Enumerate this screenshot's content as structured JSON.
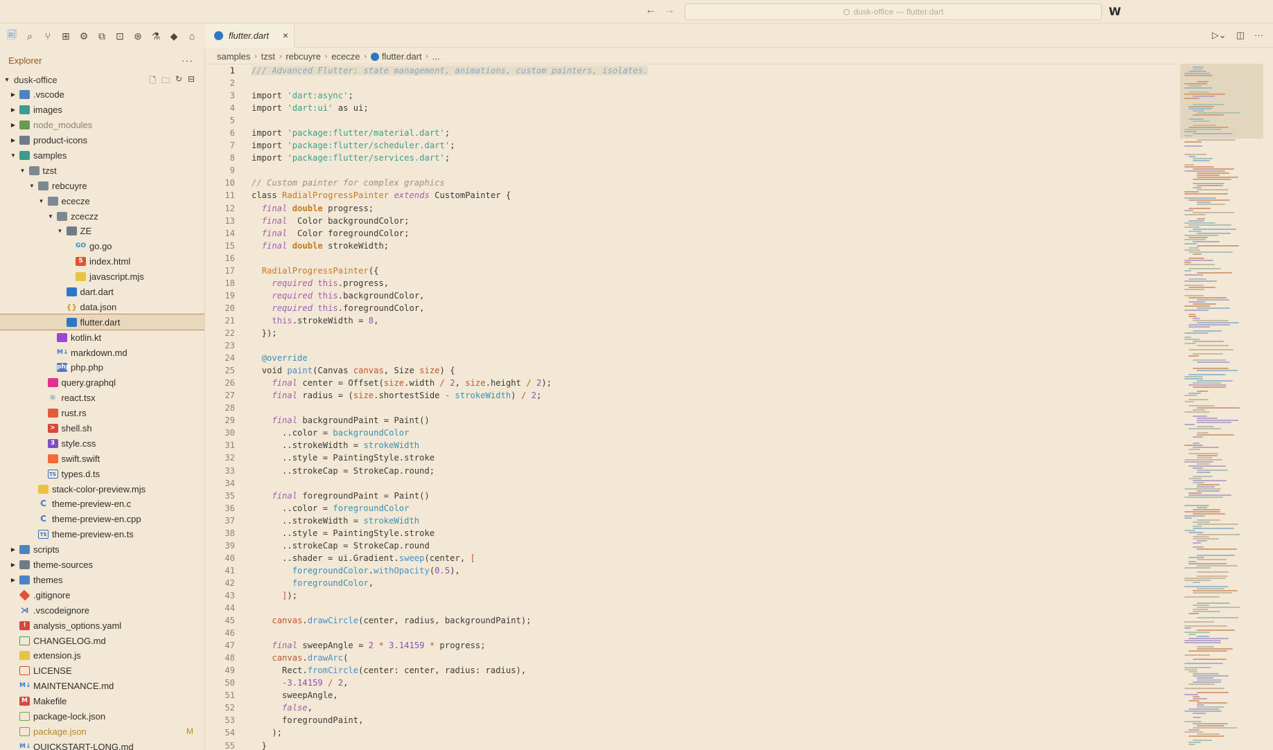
{
  "titlebar": {
    "search_text": "dusk-office — flutter.dart",
    "back_icon": "arrow-left-icon",
    "forward_icon": "arrow-right-icon",
    "logo_text": "W"
  },
  "activity": [
    "files-icon",
    "search-icon",
    "source-control-icon",
    "map-icon",
    "debug-icon",
    "remote-icon",
    "extensions-icon",
    "settings-sync-icon",
    "testing-icon",
    "dart-icon",
    "docker-icon"
  ],
  "sidebar": {
    "title": "Explorer",
    "more": "···",
    "root": "dusk-office",
    "items": [
      {
        "label": ".vscode",
        "depth": 1,
        "chev": "▶",
        "icon": "fi-folder-blue",
        "glyph": ""
      },
      {
        "label": "images",
        "depth": 1,
        "chev": "▶",
        "icon": "fi-folder-teal",
        "glyph": ""
      },
      {
        "label": "node_modules",
        "depth": 1,
        "chev": "▶",
        "icon": "fi-folder-green",
        "glyph": "",
        "dim": true
      },
      {
        "label": "product-icons",
        "depth": 1,
        "chev": "▶",
        "icon": "fi-folder",
        "glyph": ""
      },
      {
        "label": "samples",
        "depth": 1,
        "chev": "▼",
        "icon": "fi-folder-teal",
        "glyph": ""
      },
      {
        "label": "tzst",
        "depth": 2,
        "chev": "▼",
        "icon": "fi-folder open",
        "glyph": ""
      },
      {
        "label": "rebcuyre",
        "depth": 3,
        "chev": "▼",
        "icon": "fi-folder open",
        "glyph": ""
      },
      {
        "label": "ececze",
        "depth": 4,
        "chev": "▼",
        "icon": "fi-folder open",
        "glyph": ""
      },
      {
        "label": "zceczz",
        "depth": 5,
        "chev": "▼",
        "icon": "fi-folder open",
        "glyph": ""
      },
      {
        "label": "ZE",
        "depth": 6,
        "chev": "▼",
        "icon": "fi-folder",
        "glyph": ""
      },
      {
        "label": "go.go",
        "depth": 7,
        "chev": "",
        "icon": "fi-go",
        "glyph": "GO"
      },
      {
        "label": "index.html",
        "depth": 7,
        "chev": "",
        "icon": "fi-html",
        "glyph": "5"
      },
      {
        "label": "javascript.mjs",
        "depth": 7,
        "chev": "",
        "icon": "fi-js",
        "glyph": ""
      },
      {
        "label": "dart.dart",
        "depth": 6,
        "chev": "",
        "icon": "fi-dart",
        "glyph": ""
      },
      {
        "label": "data.json",
        "depth": 6,
        "chev": "",
        "icon": "fi-json",
        "glyph": "{}"
      },
      {
        "label": "flutter.dart",
        "depth": 6,
        "chev": "",
        "icon": "fi-dart",
        "glyph": "",
        "selected": true
      },
      {
        "label": "kotlin.kt",
        "depth": 5,
        "chev": "",
        "icon": "fi-kotlin",
        "glyph": ""
      },
      {
        "label": "markdown.md",
        "depth": 5,
        "chev": "",
        "icon": "fi-md",
        "glyph": "M↓"
      },
      {
        "label": "php.php",
        "depth": 5,
        "chev": "",
        "icon": "fi-php",
        "glyph": "php"
      },
      {
        "label": "query.graphql",
        "depth": 4,
        "chev": "",
        "icon": "fi-graphql",
        "glyph": ""
      },
      {
        "label": "react.tsx",
        "depth": 4,
        "chev": "",
        "icon": "fi-react",
        "glyph": "⚛"
      },
      {
        "label": "rust.rs",
        "depth": 4,
        "chev": "",
        "icon": "fi-rust",
        "glyph": ""
      },
      {
        "label": "shell.sh",
        "depth": 4,
        "chev": "",
        "icon": "fi-shell",
        "glyph": ">"
      },
      {
        "label": "style.css",
        "depth": 4,
        "chev": "",
        "icon": "fi-css",
        "glyph": "3"
      },
      {
        "label": "swift.swift",
        "depth": 4,
        "chev": "",
        "icon": "fi-swift",
        "glyph": ""
      },
      {
        "label": "types.d.ts",
        "depth": 4,
        "chev": "",
        "icon": "fi-ts",
        "glyph": "TS"
      },
      {
        "label": "stack-color-preview.mjs",
        "depth": 3,
        "chev": "",
        "icon": "fi-js",
        "glyph": ""
      },
      {
        "label": "theme-preview-en.c",
        "depth": 3,
        "chev": "",
        "icon": "fi-c",
        "glyph": "C"
      },
      {
        "label": "theme-preview-en.cpp",
        "depth": 3,
        "chev": "",
        "icon": "fi-cpp",
        "glyph": "C"
      },
      {
        "label": "theme-preview-en.ts",
        "depth": 3,
        "chev": "",
        "icon": "fi-ts",
        "glyph": "TS"
      },
      {
        "label": "scripts",
        "depth": 1,
        "chev": "▶",
        "icon": "fi-folder-blue",
        "glyph": ""
      },
      {
        "label": "theme-sources",
        "depth": 1,
        "chev": "▶",
        "icon": "fi-folder",
        "glyph": ""
      },
      {
        "label": "themes",
        "depth": 1,
        "chev": "▶",
        "icon": "fi-folder-blue",
        "glyph": ""
      },
      {
        "label": ".gitignore",
        "depth": 1,
        "chev": "",
        "icon": "fi-git",
        "glyph": ""
      },
      {
        "label": ".vscodeignore",
        "depth": 1,
        "chev": "",
        "icon": "fi-vscode",
        "glyph": "⋊"
      },
      {
        "label": "analysis_options.yaml",
        "depth": 1,
        "chev": "",
        "icon": "fi-yaml",
        "glyph": "!"
      },
      {
        "label": "CHANGELOG.md",
        "depth": 1,
        "chev": "",
        "icon": "fi-clock",
        "glyph": ""
      },
      {
        "label": "extension.js",
        "depth": 1,
        "chev": "",
        "icon": "fi-js",
        "glyph": ""
      },
      {
        "label": "LICENSE",
        "depth": 1,
        "chev": "",
        "icon": "fi-license",
        "glyph": ""
      },
      {
        "label": "MAINTENANCE.md",
        "depth": 1,
        "chev": "",
        "icon": "fi-md",
        "glyph": "M↓"
      },
      {
        "label": "Makefile",
        "depth": 1,
        "chev": "",
        "icon": "fi-make",
        "glyph": "M"
      },
      {
        "label": "package-lock.json",
        "depth": 1,
        "chev": "",
        "icon": "fi-npm",
        "glyph": ""
      },
      {
        "label": "package.json",
        "depth": 1,
        "chev": "",
        "icon": "fi-npm",
        "glyph": "",
        "modified": true,
        "badge": "M"
      },
      {
        "label": "QUICKSTART-LONG.md",
        "depth": 1,
        "chev": "",
        "icon": "fi-md",
        "glyph": "M↓"
      }
    ]
  },
  "tab": {
    "label": "flutter.dart",
    "close": "×"
  },
  "tab_actions": [
    "run-icon",
    "split-editor-icon",
    "more-icon"
  ],
  "breadcrumbs": [
    "samples",
    "tzst",
    "rebcuyre",
    "ececze",
    "flutter.dart",
    "..."
  ],
  "editor": {
    "current_line": 1,
    "lines": [
      [
        [
          "c-doc",
          "/// Advanced Flutter: state management, animations, custom painters, isolates."
        ]
      ],
      [],
      [
        [
          "c-kw",
          "import "
        ],
        [
          "c-str",
          "'dart:async'"
        ],
        [
          "",
          "; "
        ]
      ],
      [
        [
          "c-kw",
          "import "
        ],
        [
          "c-str",
          "'dart:ui'"
        ],
        [
          "c-kw",
          " as "
        ],
        [
          "",
          "ui;"
        ]
      ],
      [],
      [
        [
          "c-kw",
          "import "
        ],
        [
          "c-str",
          "'package:flutter/material.dart'"
        ],
        [
          "",
          ";"
        ]
      ],
      [
        [
          "c-kw",
          "import "
        ],
        [
          "c-str",
          "'package:flutter/scheduler.dart'"
        ],
        [
          "",
          ";"
        ]
      ],
      [
        [
          "c-kw",
          "import "
        ],
        [
          "c-str",
          "'package:flutter/services.dart'"
        ],
        [
          "",
          ";"
        ]
      ],
      [],
      [
        [
          "c-cmt",
          "// Custom painter for complex graphics"
        ]
      ],
      [
        [
          "c-kw",
          "class "
        ],
        [
          "c-cls",
          "RadialProgressPainter"
        ],
        [
          "c-it",
          " extends "
        ],
        [
          "",
          "CustomPainter {"
        ]
      ],
      [
        [
          "",
          "  "
        ],
        [
          "c-it",
          "final "
        ],
        [
          "c-kwb",
          "double"
        ],
        [
          "",
          " progress;"
        ]
      ],
      [
        [
          "",
          "  "
        ],
        [
          "c-it",
          "final "
        ],
        [
          "",
          " Color backgroundColor;"
        ]
      ],
      [
        [
          "",
          "  "
        ],
        [
          "c-it",
          "final "
        ],
        [
          "",
          " Color foregroundColor;"
        ]
      ],
      [
        [
          "",
          "  "
        ],
        [
          "c-it",
          "final "
        ],
        [
          "c-kwb",
          "double"
        ],
        [
          "",
          " strokeWidth;"
        ]
      ],
      [],
      [
        [
          "",
          "  "
        ],
        [
          "c-cls",
          "RadialProgressPainter"
        ],
        [
          "",
          "({"
        ]
      ],
      [
        [
          "",
          "    "
        ],
        [
          "c-it",
          "required "
        ],
        [
          "c-this",
          "this"
        ],
        [
          "",
          ".progress,"
        ]
      ],
      [
        [
          "",
          "    "
        ],
        [
          "c-it",
          "required "
        ],
        [
          "c-this",
          "this"
        ],
        [
          "",
          ".backgroundColor,"
        ]
      ],
      [
        [
          "",
          "    "
        ],
        [
          "c-it",
          "required "
        ],
        [
          "c-this",
          "this"
        ],
        [
          "",
          ".foregroundColor,"
        ]
      ],
      [
        [
          "",
          "    "
        ],
        [
          "c-this",
          "this"
        ],
        [
          "",
          ".strokeWidth = "
        ],
        [
          "c-num",
          "8"
        ],
        [
          "",
          ","
        ]
      ],
      [
        [
          "",
          "  });"
        ]
      ],
      [],
      [
        [
          "",
          "  "
        ],
        [
          "c-at",
          "@override"
        ]
      ],
      [
        [
          "",
          "  "
        ],
        [
          "c-kw",
          "void "
        ],
        [
          "c-fn",
          "paint"
        ],
        [
          "",
          "(Canvas "
        ],
        [
          "c-var",
          "canvas"
        ],
        [
          "",
          ", Size "
        ],
        [
          "c-var",
          "size"
        ],
        [
          "",
          ") {"
        ]
      ],
      [
        [
          "",
          "    "
        ],
        [
          "c-it",
          "final "
        ],
        [
          "",
          "center = Offset("
        ],
        [
          "c-var",
          "size"
        ],
        [
          "",
          ".width "
        ],
        [
          "c-op",
          "/"
        ],
        [
          "",
          " "
        ],
        [
          "c-num",
          "2"
        ],
        [
          "",
          ", "
        ],
        [
          "c-var",
          "size"
        ],
        [
          "",
          ".height "
        ],
        [
          "c-op",
          "/"
        ],
        [
          "",
          " "
        ],
        [
          "c-num",
          "2"
        ],
        [
          "",
          ");"
        ]
      ],
      [
        [
          "",
          "    "
        ],
        [
          "c-it",
          "final "
        ],
        [
          "",
          "radius = ("
        ],
        [
          "c-var",
          "size"
        ],
        [
          "",
          ".shortestSide "
        ],
        [
          "c-op",
          "-"
        ],
        [
          "",
          " "
        ],
        [
          "c-prop",
          "strokeWidth"
        ],
        [
          "",
          ") "
        ],
        [
          "c-op",
          "/"
        ],
        [
          "",
          " "
        ],
        [
          "c-num",
          "2"
        ],
        [
          "",
          ";"
        ]
      ],
      [],
      [
        [
          "",
          "    "
        ],
        [
          "c-it",
          "final "
        ],
        [
          "",
          "backgroundPaint = Paint()"
        ]
      ],
      [
        [
          "",
          "      ..color = "
        ],
        [
          "c-prop",
          "backgroundColor"
        ]
      ],
      [
        [
          "",
          "      ..strokeWidth = "
        ],
        [
          "c-prop",
          "strokeWidth"
        ]
      ],
      [
        [
          "",
          "      ..style = PaintingStyle.stroke"
        ]
      ],
      [
        [
          "",
          "      ..strokeCap = StrokeCap.round;"
        ]
      ],
      [],
      [
        [
          "",
          "    "
        ],
        [
          "c-it",
          "final "
        ],
        [
          "",
          "foregroundPaint = Paint()"
        ]
      ],
      [
        [
          "",
          "      ..color = "
        ],
        [
          "c-prop",
          "foregroundColor"
        ]
      ],
      [
        [
          "",
          "      ..strokeWidth = "
        ],
        [
          "c-prop",
          "strokeWidth"
        ]
      ],
      [
        [
          "",
          "      ..style = PaintingStyle.stroke"
        ]
      ],
      [
        [
          "",
          "      ..strokeCap = StrokeCap.round"
        ]
      ],
      [
        [
          "",
          "      ..shader = ui.Gradient."
        ],
        [
          "c-fn",
          "sweep"
        ],
        [
          "",
          "(center, "
        ],
        [
          "c-op",
          "["
        ]
      ],
      [
        [
          "",
          "        "
        ],
        [
          "c-prop",
          "foregroundColor"
        ],
        [
          "",
          "."
        ],
        [
          "c-fn",
          "withOpacity"
        ],
        [
          "",
          "("
        ],
        [
          "c-num",
          "0.5"
        ],
        [
          "",
          "),"
        ]
      ],
      [
        [
          "",
          "        "
        ],
        [
          "c-prop",
          "foregroundColor"
        ],
        [
          "",
          ","
        ]
      ],
      [
        [
          "",
          "      "
        ],
        [
          "c-op",
          "]"
        ],
        [
          "",
          ");"
        ]
      ],
      [],
      [
        [
          "",
          "    "
        ],
        [
          "c-var",
          "canvas"
        ],
        [
          "",
          "."
        ],
        [
          "c-fn",
          "drawCircle"
        ],
        [
          "",
          "(center, radius, backgroundPaint);"
        ]
      ],
      [],
      [
        [
          "",
          "    "
        ],
        [
          "c-it",
          "final "
        ],
        [
          "",
          "sweepAngle = "
        ],
        [
          "c-num",
          "2"
        ],
        [
          "",
          " "
        ],
        [
          "c-op",
          "*"
        ],
        [
          "",
          " "
        ],
        [
          "c-num",
          "3.14159"
        ],
        [
          "",
          " "
        ],
        [
          "c-op",
          "*"
        ],
        [
          "",
          " progress;"
        ]
      ],
      [
        [
          "",
          "    "
        ],
        [
          "c-var",
          "canvas"
        ],
        [
          "",
          "."
        ],
        [
          "c-fn",
          "drawArc"
        ],
        [
          "",
          "("
        ]
      ],
      [
        [
          "",
          "      Rect."
        ],
        [
          "c-fn",
          "fromCircle"
        ],
        [
          "",
          "(center: center, radius: radius),"
        ]
      ],
      [
        [
          "",
          "      "
        ],
        [
          "c-op",
          "-"
        ],
        [
          "c-num",
          "3.14159"
        ],
        [
          "",
          " "
        ],
        [
          "c-op",
          "/"
        ],
        [
          "",
          " "
        ],
        [
          "c-num",
          "2"
        ],
        [
          "",
          ","
        ]
      ],
      [
        [
          "",
          "      sweepAngle,"
        ]
      ],
      [
        [
          "",
          "      "
        ],
        [
          "c-it",
          "false"
        ],
        [
          "",
          ","
        ]
      ],
      [
        [
          "",
          "      foregroundPaint,"
        ]
      ],
      [
        [
          "",
          "    );"
        ]
      ],
      [
        [
          "",
          "  }"
        ]
      ]
    ]
  }
}
